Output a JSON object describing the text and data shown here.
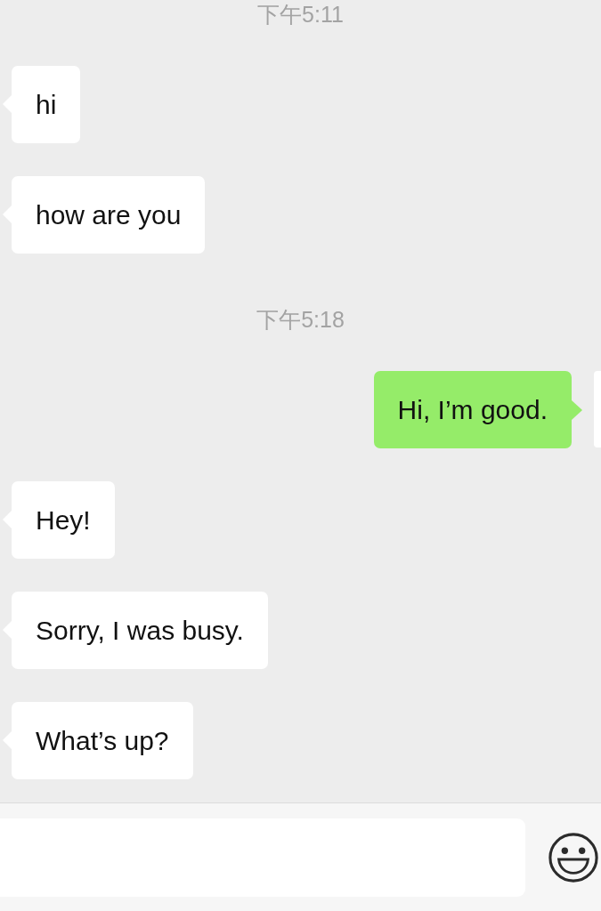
{
  "messages": [
    {
      "kind": "time",
      "text": "下午5:11"
    },
    {
      "kind": "message",
      "outgoing": false,
      "text": "hi"
    },
    {
      "kind": "message",
      "outgoing": false,
      "text": "how are you"
    },
    {
      "kind": "time",
      "text": "下午5:18"
    },
    {
      "kind": "message",
      "outgoing": true,
      "text": "Hi, I’m good."
    },
    {
      "kind": "message",
      "outgoing": false,
      "text": "Hey!"
    },
    {
      "kind": "message",
      "outgoing": false,
      "text": "Sorry, I was busy."
    },
    {
      "kind": "message",
      "outgoing": false,
      "text": "What’s up?"
    }
  ]
}
